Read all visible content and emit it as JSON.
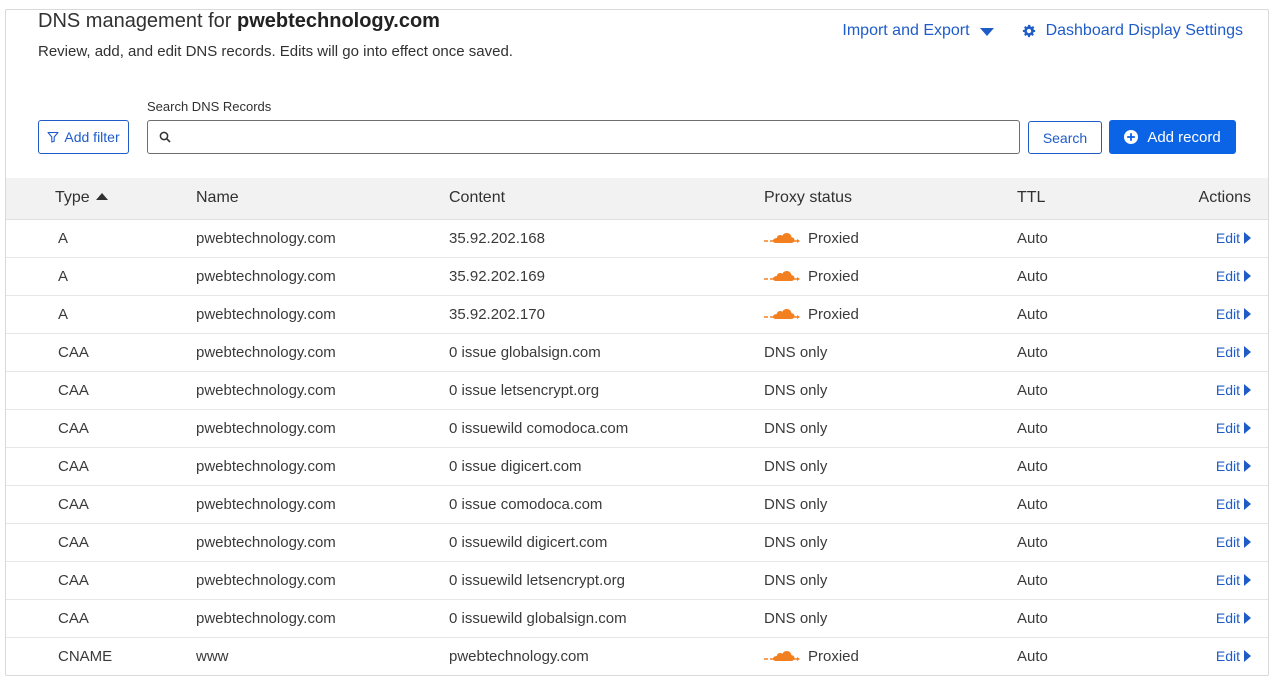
{
  "header": {
    "title_prefix": "DNS management for",
    "domain": "pwebtechnology.com",
    "subtitle": "Review, add, and edit DNS records. Edits will go into effect once saved.",
    "import_export_label": "Import and Export",
    "display_settings_label": "Dashboard Display Settings"
  },
  "toolbar": {
    "add_filter_label": "Add filter",
    "search_label": "Search DNS Records",
    "search_value": "",
    "search_button_label": "Search",
    "add_record_label": "Add record"
  },
  "table": {
    "columns": [
      "Type",
      "Name",
      "Content",
      "Proxy status",
      "TTL",
      "Actions"
    ],
    "rows": [
      {
        "type": "A",
        "name": "pwebtechnology.com",
        "content": "35.92.202.168",
        "proxy": "Proxied",
        "ttl": "Auto",
        "action": "Edit"
      },
      {
        "type": "A",
        "name": "pwebtechnology.com",
        "content": "35.92.202.169",
        "proxy": "Proxied",
        "ttl": "Auto",
        "action": "Edit"
      },
      {
        "type": "A",
        "name": "pwebtechnology.com",
        "content": "35.92.202.170",
        "proxy": "Proxied",
        "ttl": "Auto",
        "action": "Edit"
      },
      {
        "type": "CAA",
        "name": "pwebtechnology.com",
        "content": "0 issue globalsign.com",
        "proxy": "DNS only",
        "ttl": "Auto",
        "action": "Edit"
      },
      {
        "type": "CAA",
        "name": "pwebtechnology.com",
        "content": "0 issue letsencrypt.org",
        "proxy": "DNS only",
        "ttl": "Auto",
        "action": "Edit"
      },
      {
        "type": "CAA",
        "name": "pwebtechnology.com",
        "content": "0 issuewild comodoca.com",
        "proxy": "DNS only",
        "ttl": "Auto",
        "action": "Edit"
      },
      {
        "type": "CAA",
        "name": "pwebtechnology.com",
        "content": "0 issue digicert.com",
        "proxy": "DNS only",
        "ttl": "Auto",
        "action": "Edit"
      },
      {
        "type": "CAA",
        "name": "pwebtechnology.com",
        "content": "0 issue comodoca.com",
        "proxy": "DNS only",
        "ttl": "Auto",
        "action": "Edit"
      },
      {
        "type": "CAA",
        "name": "pwebtechnology.com",
        "content": "0 issuewild digicert.com",
        "proxy": "DNS only",
        "ttl": "Auto",
        "action": "Edit"
      },
      {
        "type": "CAA",
        "name": "pwebtechnology.com",
        "content": "0 issuewild letsencrypt.org",
        "proxy": "DNS only",
        "ttl": "Auto",
        "action": "Edit"
      },
      {
        "type": "CAA",
        "name": "pwebtechnology.com",
        "content": "0 issuewild globalsign.com",
        "proxy": "DNS only",
        "ttl": "Auto",
        "action": "Edit"
      },
      {
        "type": "CNAME",
        "name": "www",
        "content": "pwebtechnology.com",
        "proxy": "Proxied",
        "ttl": "Auto",
        "action": "Edit"
      }
    ]
  },
  "icons": {
    "proxied": "orange-cloud-icon",
    "filter": "funnel-icon",
    "search": "magnifier-icon",
    "settings": "gear-icon",
    "add": "plus-circle-icon"
  },
  "colors": {
    "accent": "#1f5cc8",
    "primary_button": "#0b63e6",
    "proxied_cloud": "#f38020"
  }
}
